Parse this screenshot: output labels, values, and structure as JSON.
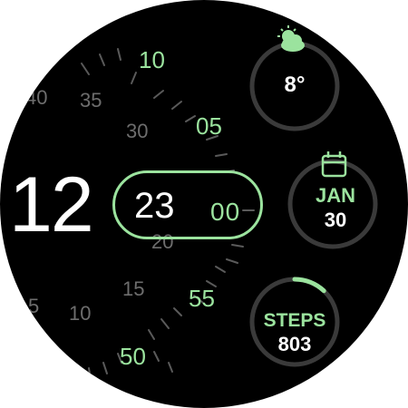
{
  "watch_face": {
    "time": {
      "hour": "12",
      "minute": "23",
      "second": "00"
    },
    "colors": {
      "accent": "#9be39e",
      "primary_text": "#ffffff",
      "dim_text": "#6d6d6d",
      "ring_track": "#3a3a3a",
      "background": "#000000"
    },
    "dial_labels": {
      "accent": [
        "10",
        "05",
        "55",
        "50"
      ],
      "dim": [
        "40",
        "35",
        "30",
        "20",
        "15",
        "10",
        "5"
      ]
    },
    "complications": {
      "weather": {
        "icon": "partly-cloudy-icon",
        "value": "8°"
      },
      "date": {
        "icon": "calendar-icon",
        "month": "JAN",
        "day": "30"
      },
      "steps": {
        "label": "STEPS",
        "value": "803",
        "progress": 0.12
      }
    }
  }
}
